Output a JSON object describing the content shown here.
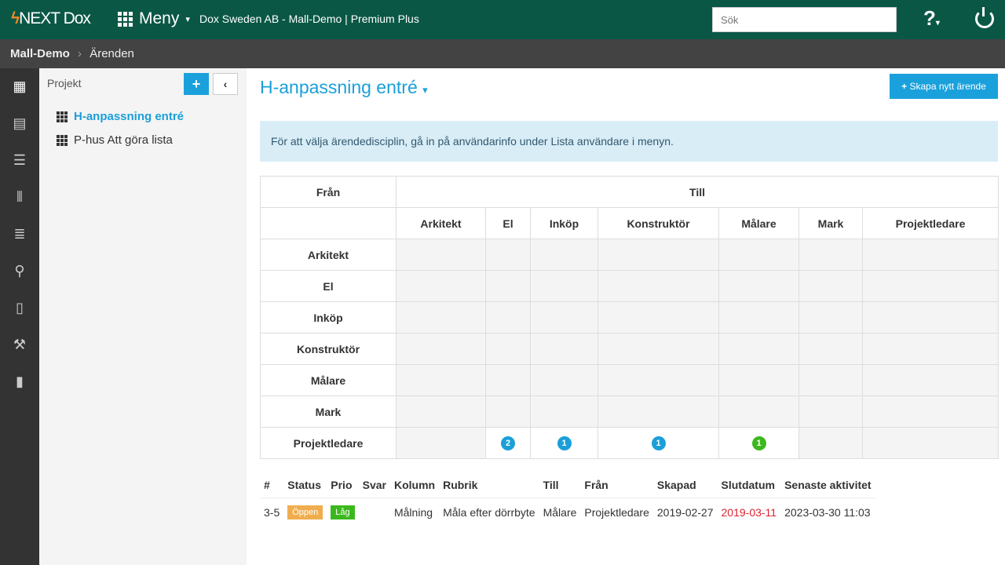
{
  "header": {
    "logo": "NEXT Dox",
    "menu": "Meny",
    "context": "Dox Sweden AB - Mall-Demo | Premium Plus",
    "search_placeholder": "Sök",
    "help": "?"
  },
  "breadcrumb": {
    "root": "Mall-Demo",
    "current": "Ärenden"
  },
  "rail": [
    "grid-icon",
    "calendar-icon",
    "server-icon",
    "kanban-icon",
    "list-icon",
    "map-pin-icon",
    "document-icon",
    "hammer-icon",
    "bar-chart-icon"
  ],
  "sidebar": {
    "title": "Projekt",
    "projects": [
      {
        "label": "H-anpassning entré",
        "active": true
      },
      {
        "label": "P-hus Att göra lista",
        "active": false
      }
    ]
  },
  "main": {
    "title": "H-anpassning entré",
    "new_button": "Skapa nytt ärende",
    "info": "För att välja ärendedisciplin, gå in på användarinfo under Lista användare i menyn."
  },
  "matrix": {
    "from_label": "Från",
    "to_label": "Till",
    "columns": [
      "Arkitekt",
      "El",
      "Inköp",
      "Konstruktör",
      "Målare",
      "Mark",
      "Projektledare"
    ],
    "rows": [
      {
        "label": "Arkitekt",
        "cells": [
          null,
          null,
          null,
          null,
          null,
          null,
          null
        ]
      },
      {
        "label": "El",
        "cells": [
          null,
          null,
          null,
          null,
          null,
          null,
          null
        ]
      },
      {
        "label": "Inköp",
        "cells": [
          null,
          null,
          null,
          null,
          null,
          null,
          null
        ]
      },
      {
        "label": "Konstruktör",
        "cells": [
          null,
          null,
          null,
          null,
          null,
          null,
          null
        ]
      },
      {
        "label": "Målare",
        "cells": [
          null,
          null,
          null,
          null,
          null,
          null,
          null
        ]
      },
      {
        "label": "Mark",
        "cells": [
          null,
          null,
          null,
          null,
          null,
          null,
          null
        ]
      },
      {
        "label": "Projektledare",
        "cells": [
          null,
          {
            "count": "2",
            "color": "#1a9fd9"
          },
          {
            "count": "1",
            "color": "#1a9fd9"
          },
          {
            "count": "1",
            "color": "#1a9fd9"
          },
          {
            "count": "1",
            "color": "#3cb81e"
          },
          null,
          null
        ]
      }
    ]
  },
  "list": {
    "headers": [
      "#",
      "Status",
      "Prio",
      "Svar",
      "Kolumn",
      "Rubrik",
      "Till",
      "Från",
      "Skapad",
      "Slutdatum",
      "Senaste aktivitet"
    ],
    "rows": [
      {
        "id": "3-5",
        "status": "Öppen",
        "status_color": "#f0ad4e",
        "prio": "Låg",
        "prio_color": "#3cb81e",
        "svar": "",
        "kolumn": "Målning",
        "rubrik": "Måla efter dörrbyte",
        "till": "Målare",
        "fran": "Projektledare",
        "skapad": "2019-02-27",
        "slutdatum": "2019-03-11",
        "slutdatum_color": "#d9232e",
        "senaste": "2023-03-30 11:03"
      }
    ]
  }
}
